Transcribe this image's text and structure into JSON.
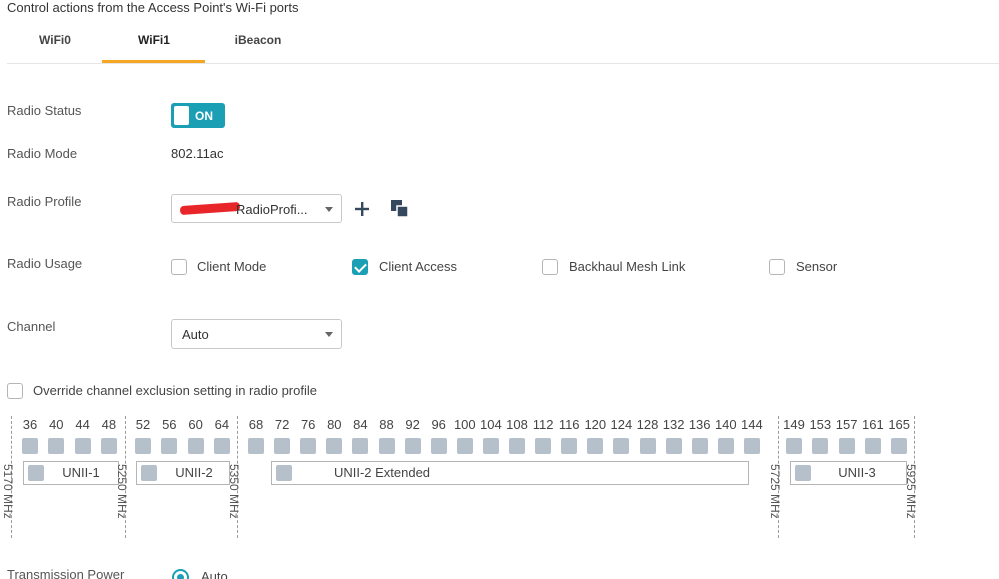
{
  "heading": "Control actions from the Access Point's Wi-Fi ports",
  "tabs": [
    {
      "label": "WiFi0",
      "active": false
    },
    {
      "label": "WiFi1",
      "active": true
    },
    {
      "label": "iBeacon",
      "active": false
    }
  ],
  "radio_status": {
    "label": "Radio Status",
    "toggle": "ON"
  },
  "radio_mode": {
    "label": "Radio Mode",
    "value": "802.11ac"
  },
  "radio_profile": {
    "label": "Radio Profile",
    "value": "RadioProfi...",
    "add_icon": "plus-icon",
    "copy_icon": "copy-icon"
  },
  "radio_usage": {
    "label": "Radio Usage",
    "options": [
      {
        "label": "Client Mode",
        "checked": false
      },
      {
        "label": "Client Access",
        "checked": true
      },
      {
        "label": "Backhaul Mesh Link",
        "checked": false
      },
      {
        "label": "Sensor",
        "checked": false
      }
    ]
  },
  "channel": {
    "label": "Channel",
    "value": "Auto"
  },
  "override": {
    "label": "Override channel exclusion setting in radio profile",
    "checked": false
  },
  "channels": [
    "36",
    "40",
    "44",
    "48",
    "52",
    "56",
    "60",
    "64",
    "68",
    "72",
    "76",
    "80",
    "84",
    "88",
    "92",
    "96",
    "100",
    "104",
    "108",
    "112",
    "116",
    "120",
    "124",
    "128",
    "132",
    "136",
    "140",
    "144",
    "149",
    "153",
    "157",
    "161",
    "165"
  ],
  "bands": [
    "UNII-1",
    "UNII-2",
    "UNII-2 Extended",
    "UNII-3"
  ],
  "frequencies": [
    "5170 MHz",
    "5250 MHz",
    "5350 MHz",
    "5725 MHz",
    "5925 MHz"
  ],
  "transmission_power": {
    "label": "Transmission Power",
    "option": "Auto"
  },
  "colors": {
    "accent": "#1a9fb5",
    "tab_underline": "#f5a623",
    "channel_square": "#b6c0cb"
  }
}
